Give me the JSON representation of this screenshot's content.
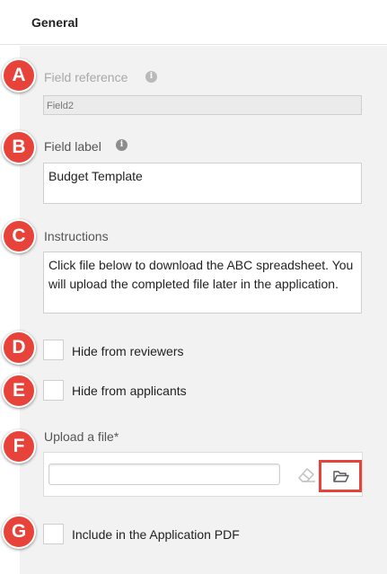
{
  "header": {
    "title": "General"
  },
  "markers": [
    "A",
    "B",
    "C",
    "D",
    "E",
    "F",
    "G"
  ],
  "field_reference": {
    "label": "Field reference",
    "value": "Field2"
  },
  "field_label": {
    "label": "Field label",
    "value": "Budget Template"
  },
  "instructions": {
    "label": "Instructions",
    "value": "Click file below to download the ABC spreadsheet. You will upload the completed file later in the application."
  },
  "hide_reviewers": {
    "label": "Hide from reviewers",
    "checked": false
  },
  "hide_applicants": {
    "label": "Hide from applicants",
    "checked": false
  },
  "upload": {
    "label": "Upload a file*",
    "value": "",
    "clear_icon": "eraser-icon",
    "browse_icon": "folder-open-icon",
    "highlight_color": "#e8433a"
  },
  "include_pdf": {
    "label": "Include in the Application PDF",
    "checked": false
  },
  "colors": {
    "marker": "#e8433a",
    "panel": "#f2f2f2"
  }
}
